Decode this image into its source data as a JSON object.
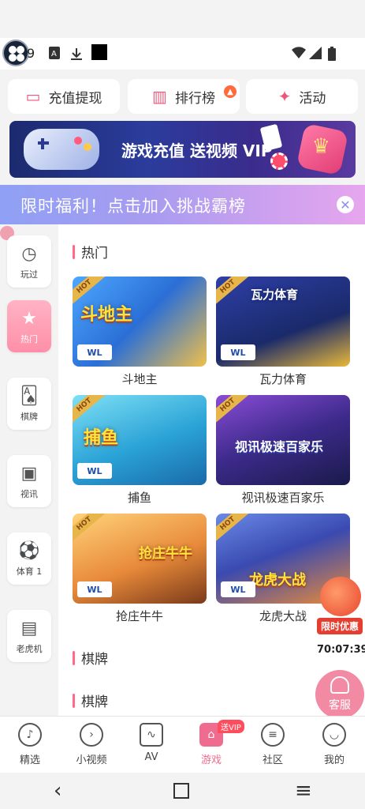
{
  "status_bar": {
    "time": "9"
  },
  "top_tabs": [
    {
      "label": "充值提现",
      "icon": "wallet-icon"
    },
    {
      "label": "排行榜",
      "icon": "bar-chart-icon",
      "badge": "hot"
    },
    {
      "label": "活动",
      "icon": "party-popper-icon"
    }
  ],
  "banner": {
    "text": "游戏充值 送视频 VIP"
  },
  "promo_strip": {
    "text": "限时福利！点击加入挑战霸榜"
  },
  "sidebar": {
    "items": [
      {
        "label": "玩过",
        "icon": "clock-icon"
      },
      {
        "label": "热门",
        "icon": "star-icon",
        "active": true
      },
      {
        "label": "棋牌",
        "icon": "cards-icon"
      },
      {
        "label": "视讯",
        "icon": "camera-icon"
      },
      {
        "label": "体育 1",
        "icon": "soccer-ball-icon"
      },
      {
        "label": "老虎机",
        "icon": "slot-machine-icon"
      }
    ]
  },
  "sections": {
    "hot": "热门",
    "chess1": "棋牌",
    "chess2": "棋牌"
  },
  "games": [
    {
      "name": "斗地主",
      "art": "斗地主",
      "tag": "HOT",
      "logo": "WL"
    },
    {
      "name": "瓦力体育",
      "art": "瓦力体育",
      "tag": "HOT",
      "logo": "WL"
    },
    {
      "name": "捕鱼",
      "art": "捕鱼",
      "tag": "HOT",
      "logo": "WL"
    },
    {
      "name": "视讯极速百家乐",
      "art": "视讯极速百家乐",
      "tag": "HOT",
      "logo": "WL"
    },
    {
      "name": "抢庄牛牛",
      "art": "抢庄牛牛",
      "tag": "HOT",
      "logo": "WL"
    },
    {
      "name": "龙虎大战",
      "art": "龙虎大战",
      "tag": "HOT",
      "logo": "WL"
    }
  ],
  "float_promo": {
    "label": "限时优惠",
    "timer": "70:07:39"
  },
  "customer_service": {
    "label": "客服"
  },
  "bottom_nav": [
    {
      "label": "精选",
      "icon": "music-note-icon"
    },
    {
      "label": "小视频",
      "icon": "play-circle-icon"
    },
    {
      "label": "AV",
      "icon": "tv-icon"
    },
    {
      "label": "游戏",
      "icon": "game-home-icon",
      "active": true,
      "badge": "送VIP"
    },
    {
      "label": "社区",
      "icon": "chat-bubble-icon"
    },
    {
      "label": "我的",
      "icon": "smile-icon"
    }
  ],
  "colors": {
    "accent": "#f06c8e",
    "strip_start": "#8fa0f5",
    "strip_end": "#e7a6ee"
  }
}
